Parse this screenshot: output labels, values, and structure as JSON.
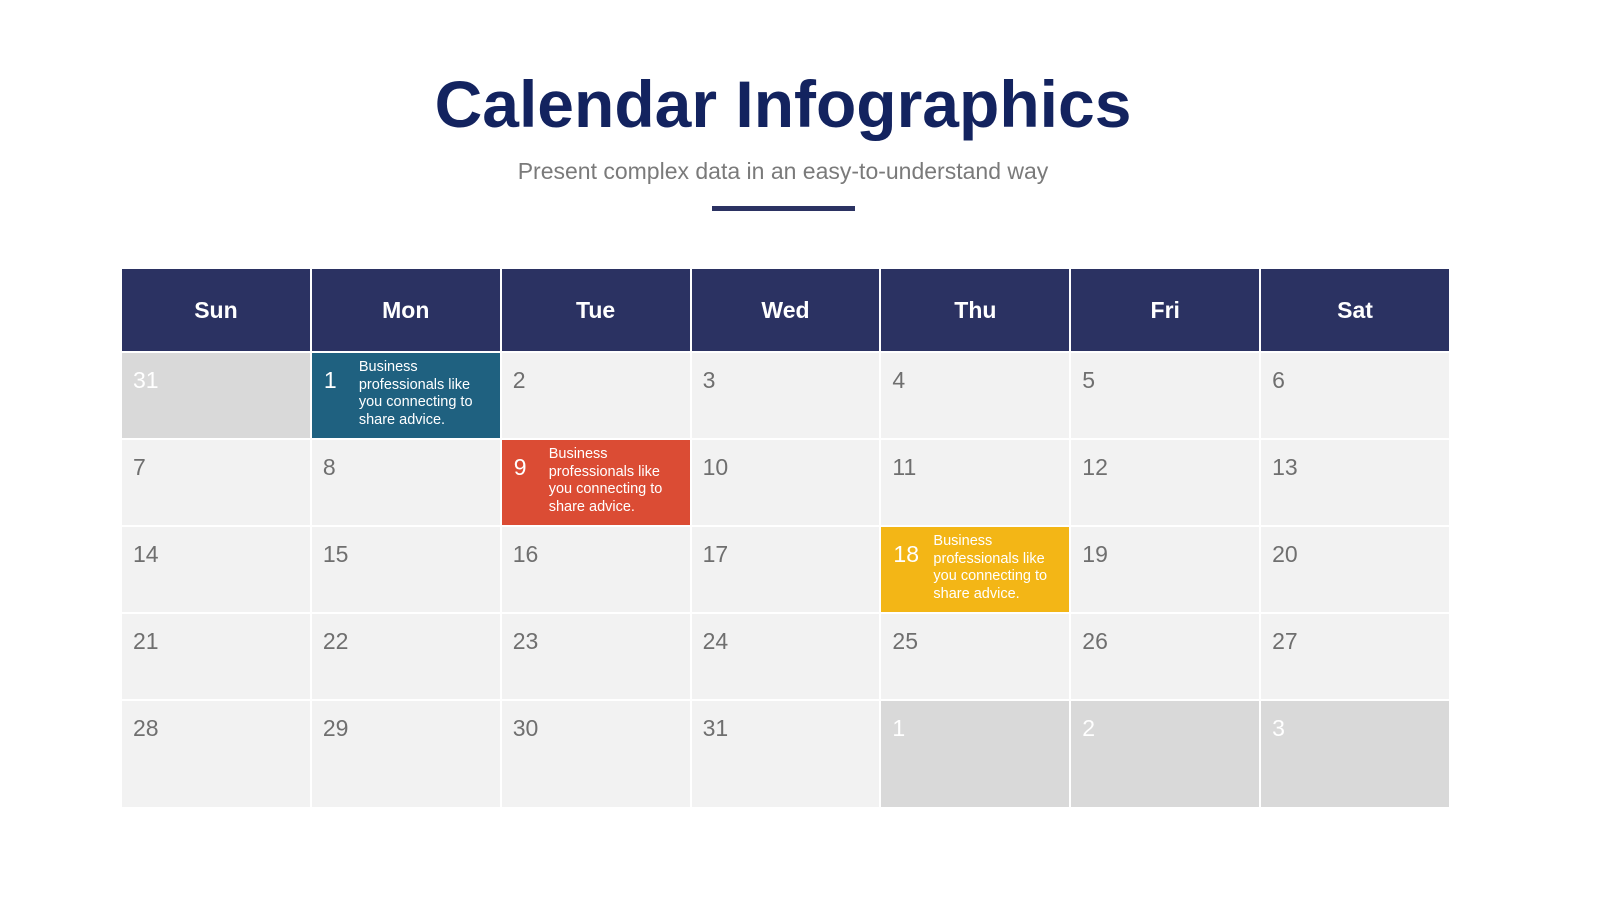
{
  "header": {
    "title": "Calendar Infographics",
    "subtitle": "Present complex data in an easy-to-understand way"
  },
  "colors": {
    "title": "#13235f",
    "header_bg": "#2b3262",
    "cell_bg": "#f2f2f2",
    "other_month_bg": "#d9d9d9",
    "event_blue": "#1f6180",
    "event_red": "#db4c34",
    "event_yellow": "#f3b616"
  },
  "calendar": {
    "weekdays": [
      "Sun",
      "Mon",
      "Tue",
      "Wed",
      "Thu",
      "Fri",
      "Sat"
    ],
    "weeks": [
      [
        {
          "day": "31",
          "other": true
        },
        {
          "day": "1",
          "event": "blue",
          "note": "Business professionals like you connecting to share advice."
        },
        {
          "day": "2"
        },
        {
          "day": "3"
        },
        {
          "day": "4"
        },
        {
          "day": "5"
        },
        {
          "day": "6"
        }
      ],
      [
        {
          "day": "7"
        },
        {
          "day": "8"
        },
        {
          "day": "9",
          "event": "red",
          "note": "Business professionals like you connecting to share advice."
        },
        {
          "day": "10"
        },
        {
          "day": "11"
        },
        {
          "day": "12"
        },
        {
          "day": "13"
        }
      ],
      [
        {
          "day": "14"
        },
        {
          "day": "15"
        },
        {
          "day": "16"
        },
        {
          "day": "17"
        },
        {
          "day": "18",
          "event": "yellow",
          "note": "Business professionals like you connecting to share advice."
        },
        {
          "day": "19"
        },
        {
          "day": "20"
        }
      ],
      [
        {
          "day": "21"
        },
        {
          "day": "22"
        },
        {
          "day": "23"
        },
        {
          "day": "24"
        },
        {
          "day": "25"
        },
        {
          "day": "26"
        },
        {
          "day": "27"
        }
      ],
      [
        {
          "day": "28"
        },
        {
          "day": "29"
        },
        {
          "day": "30"
        },
        {
          "day": "31"
        },
        {
          "day": "1",
          "other": true
        },
        {
          "day": "2",
          "other": true
        },
        {
          "day": "3",
          "other": true
        }
      ]
    ]
  }
}
